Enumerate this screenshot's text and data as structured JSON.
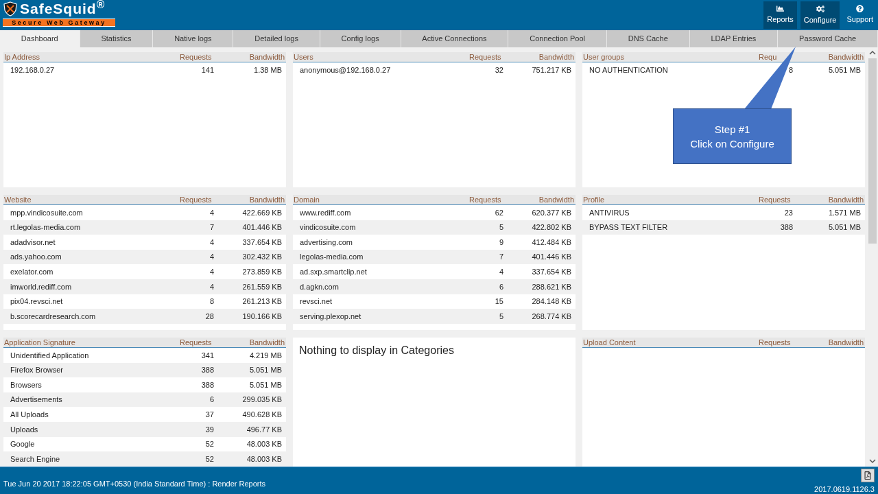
{
  "header": {
    "logo": {
      "name": "SafeSquid$^{®}$",
      "tagline": "Secure Web Gateway"
    },
    "buttons": [
      {
        "kind": "reports",
        "label": "Reports",
        "highlighted": true
      },
      {
        "kind": "configure",
        "label": "Configure",
        "highlighted": true
      },
      {
        "kind": "support",
        "label": "Support",
        "highlighted": false
      }
    ]
  },
  "tabs": [
    {
      "label": "Dashboard",
      "selected": true
    },
    {
      "label": "Statistics",
      "selected": false
    },
    {
      "label": "Native logs",
      "selected": false
    },
    {
      "label": "Detailed logs",
      "selected": false
    },
    {
      "label": "Config logs",
      "selected": false
    },
    {
      "label": "Active Connections",
      "selected": false
    },
    {
      "label": "Connection Pool",
      "selected": false
    },
    {
      "label": "DNS Cache",
      "selected": false
    },
    {
      "label": "LDAP Entries",
      "selected": false
    },
    {
      "label": "Password Cache",
      "selected": false
    }
  ],
  "panels": [
    {
      "kind": "table",
      "columns": [
        "Ip Address",
        "Requests",
        "Bandwidth"
      ],
      "rows": [
        [
          "192.168.0.27",
          "141",
          "1.38 MB"
        ]
      ]
    },
    {
      "kind": "table",
      "columns": [
        "Users",
        "Requests",
        "Bandwidth"
      ],
      "rows": [
        [
          "anonymous@192.168.0.27",
          "32",
          "751.217 KB"
        ]
      ]
    },
    {
      "kind": "table",
      "columns": [
        "User groups",
        "Requ",
        "Bandwidth"
      ],
      "rows": [
        [
          "NO AUTHENTICATION",
          "8",
          "5.051 MB"
        ]
      ]
    },
    {
      "kind": "table",
      "columns": [
        "Website",
        "Requests",
        "Bandwidth"
      ],
      "rows": [
        [
          "mpp.vindicosuite.com",
          "4",
          "422.669 KB"
        ],
        [
          "rt.legolas-media.com",
          "7",
          "401.446 KB"
        ],
        [
          "adadvisor.net",
          "4",
          "337.654 KB"
        ],
        [
          "ads.yahoo.com",
          "4",
          "302.432 KB"
        ],
        [
          "exelator.com",
          "4",
          "273.859 KB"
        ],
        [
          "imworld.rediff.com",
          "4",
          "261.559 KB"
        ],
        [
          "pix04.revsci.net",
          "8",
          "261.213 KB"
        ],
        [
          "b.scorecardresearch.com",
          "28",
          "190.166 KB"
        ]
      ]
    },
    {
      "kind": "table",
      "columns": [
        "Domain",
        "Requests",
        "Bandwidth"
      ],
      "rows": [
        [
          "www.rediff.com",
          "62",
          "620.377 KB"
        ],
        [
          "vindicosuite.com",
          "5",
          "422.802 KB"
        ],
        [
          "advertising.com",
          "9",
          "412.484 KB"
        ],
        [
          "legolas-media.com",
          "7",
          "401.446 KB"
        ],
        [
          "ad.sxp.smartclip.net",
          "4",
          "337.654 KB"
        ],
        [
          "d.agkn.com",
          "6",
          "288.621 KB"
        ],
        [
          "revsci.net",
          "15",
          "284.148 KB"
        ],
        [
          "serving.plexop.net",
          "5",
          "268.774 KB"
        ]
      ]
    },
    {
      "kind": "table",
      "columns": [
        "Profile",
        "Requests",
        "Bandwidth"
      ],
      "rows": [
        [
          "ANTIVIRUS",
          "23",
          "1.571 MB"
        ],
        [
          "BYPASS TEXT FILTER",
          "388",
          "5.051 MB"
        ]
      ]
    },
    {
      "kind": "table",
      "columns": [
        "Application Signature",
        "Requests",
        "Bandwidth"
      ],
      "rows": [
        [
          "Unidentified Application",
          "341",
          "4.219 MB"
        ],
        [
          "Firefox Browser",
          "388",
          "5.051 MB"
        ],
        [
          "Browsers",
          "388",
          "5.051 MB"
        ],
        [
          "Advertisements",
          "6",
          "299.035 KB"
        ],
        [
          "All Uploads",
          "37",
          "490.628 KB"
        ],
        [
          "Uploads",
          "39",
          "496.77 KB"
        ],
        [
          "Google",
          "52",
          "48.003 KB"
        ],
        [
          "Search Engine",
          "52",
          "48.003 KB"
        ]
      ]
    },
    {
      "kind": "message",
      "text": "Nothing to display in Categories"
    },
    {
      "kind": "table",
      "columns": [
        "Upload Content",
        "Requests",
        "Bandwidth"
      ]
    }
  ],
  "callout": {
    "lines": [
      "Step #1",
      "Click on Configure"
    ]
  },
  "footer": {
    "status": "Tue Jun 20 2017 18:22:05 GMT+0530 (India Standard Time) : Render Reports",
    "version": "2017.0619.1126.3"
  }
}
